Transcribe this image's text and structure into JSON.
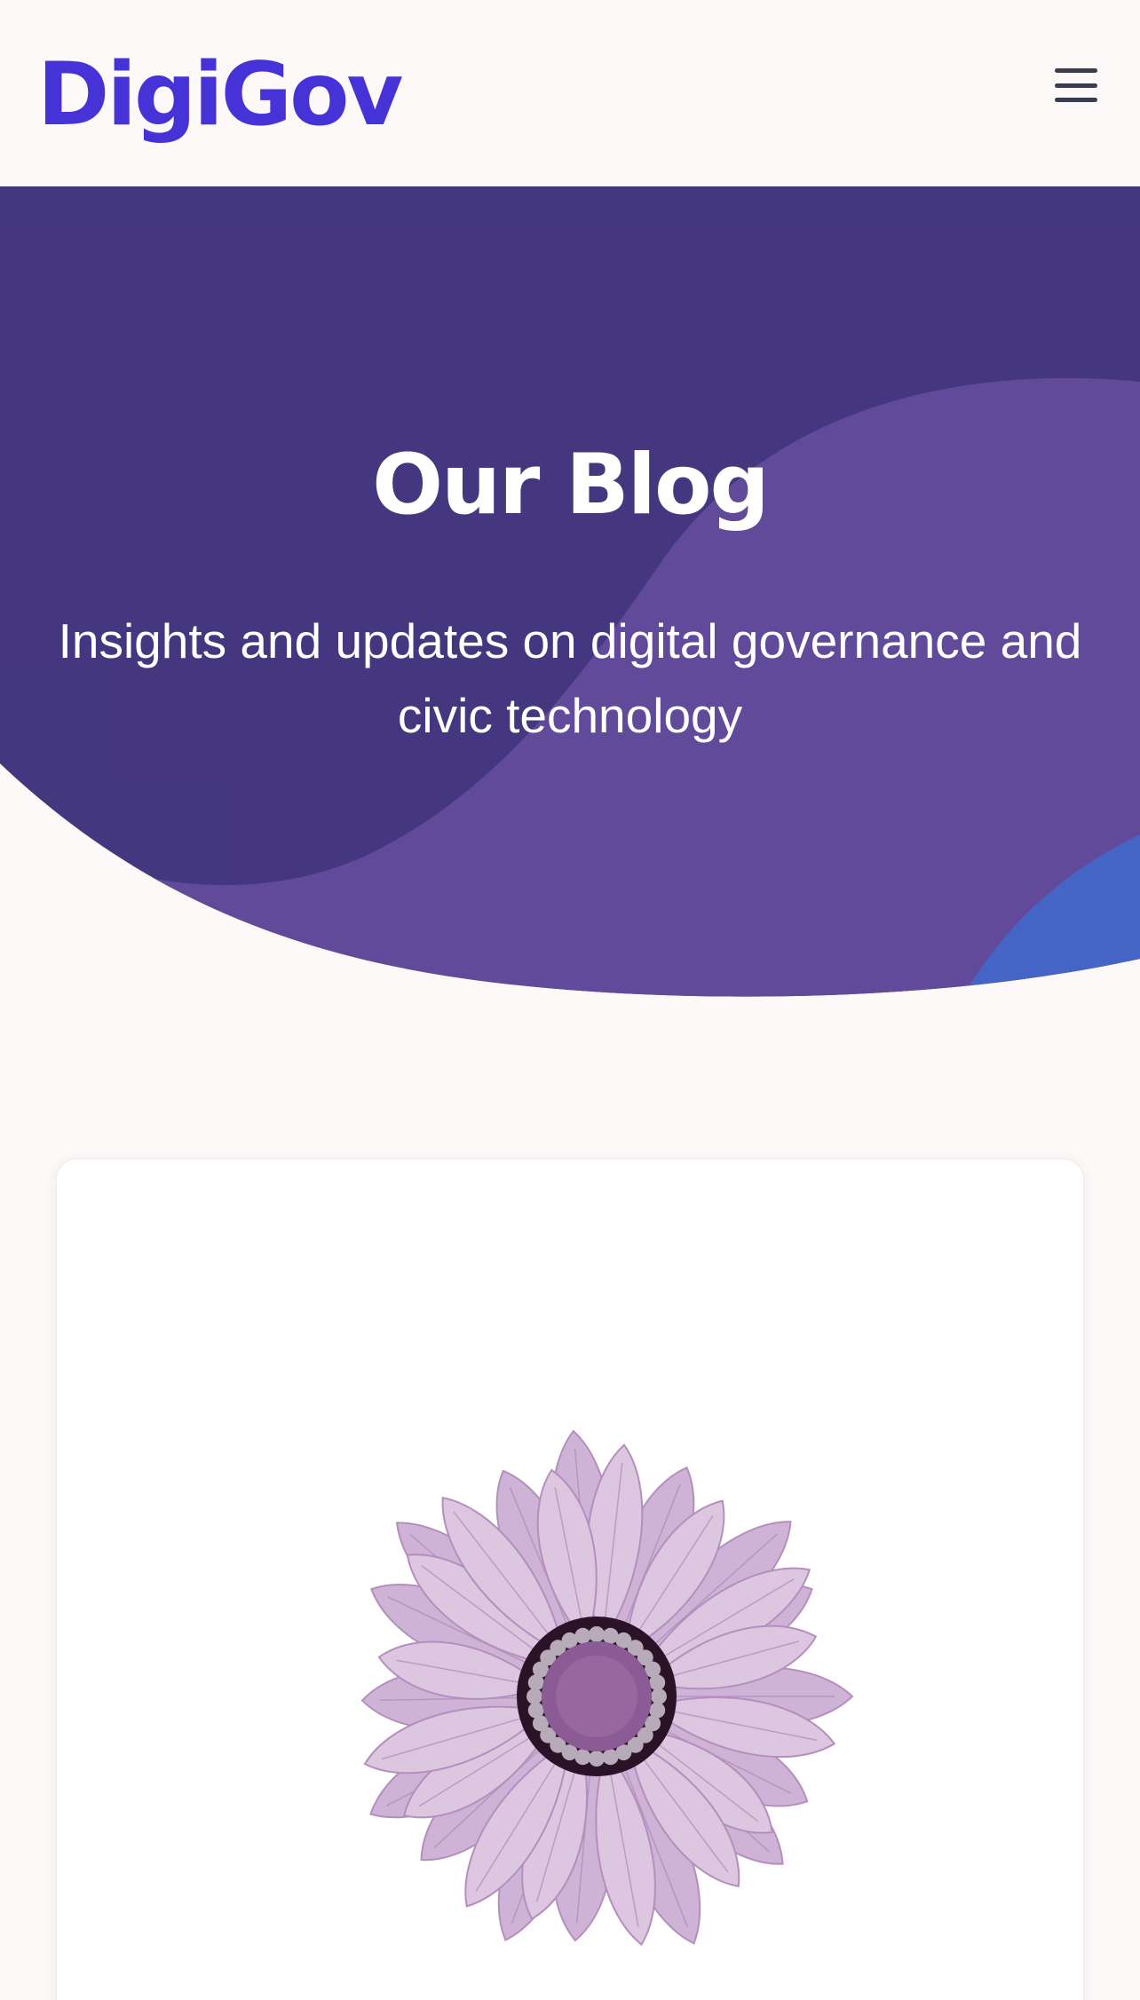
{
  "header": {
    "logo_text": "DigiGov",
    "menu_icon": "hamburger-menu-icon"
  },
  "hero": {
    "title": "Our Blog",
    "subtitle": "Insights and updates on digital governance and civic technology"
  },
  "blog_card": {
    "image_subject": "purple daisy flower illustration"
  },
  "colors": {
    "brand": "#4633d8",
    "hero_dark": "#3c2f7a",
    "hero_mid": "#5b4396",
    "hero_accent_blue": "#3d5fc4",
    "page_bg": "#fcf9f8",
    "petal": "#dcc6e0",
    "flower_center": "#8a5b94"
  }
}
